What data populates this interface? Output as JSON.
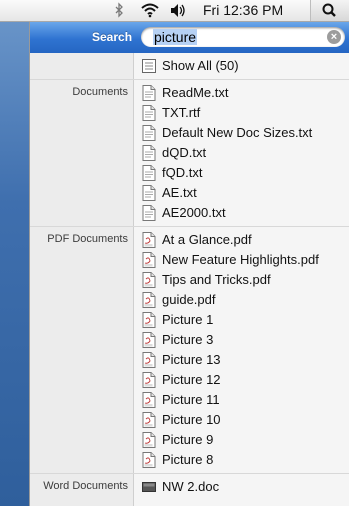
{
  "menubar": {
    "clock": "Fri 12:36 PM",
    "icons": [
      "bluetooth-icon",
      "wifi-icon",
      "volume-icon",
      "spotlight-icon"
    ]
  },
  "search": {
    "label": "Search",
    "query": "picture",
    "clear_icon": "clear-icon"
  },
  "top_hit": {
    "label": "Show All (50)",
    "icon": "show-all-icon"
  },
  "groups": [
    {
      "category": "Documents",
      "items": [
        "ReadMe.txt",
        "TXT.rtf",
        "Default New Doc Sizes.txt",
        "dQD.txt",
        "fQD.txt",
        "AE.txt",
        "AE2000.txt"
      ],
      "icon": "text-document-icon"
    },
    {
      "category": "PDF Documents",
      "items": [
        "At a Glance.pdf",
        "New Feature Highlights.pdf",
        "Tips and Tricks.pdf",
        "guide.pdf",
        "Picture 1",
        "Picture 3",
        "Picture 13",
        "Picture 12",
        "Picture 11",
        "Picture 10",
        "Picture 9",
        "Picture 8"
      ],
      "icon": "pdf-document-icon"
    },
    {
      "category": "Word Documents",
      "items": [
        "NW 2.doc"
      ],
      "icon": "word-document-icon"
    }
  ],
  "colors": {
    "search_bar": "#2f73d1",
    "selection": "#b6d1f4",
    "panel": "#f5f5f5"
  }
}
